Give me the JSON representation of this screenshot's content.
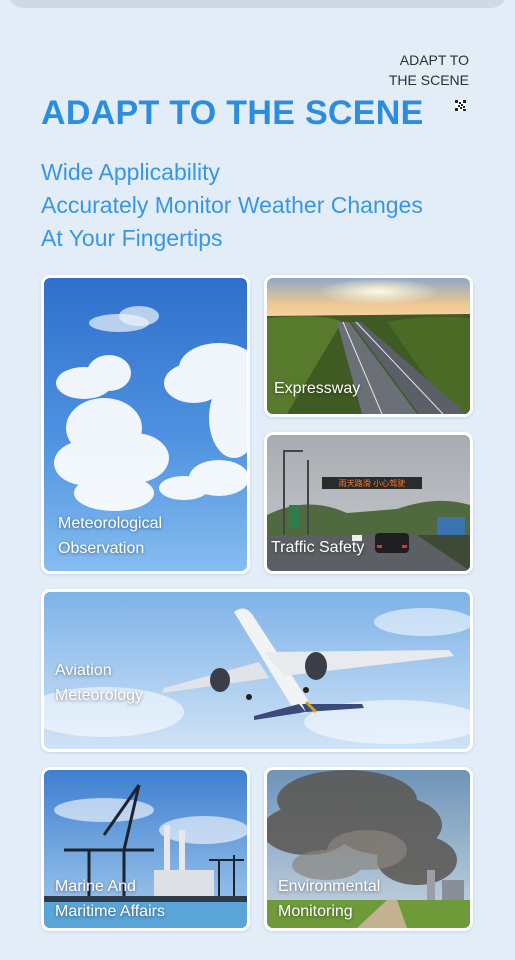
{
  "tag": {
    "line1": "ADAPT TO",
    "line2": "THE SCENE"
  },
  "heading": "ADAPT TO THE SCENE",
  "features": [
    "Wide Applicability",
    "Accurately Monitor Weather Changes",
    "At Your Fingertips"
  ],
  "cards": {
    "meteorological": {
      "line1": "Meteorological",
      "line2": "Observation",
      "icon": "sky-clouds-image"
    },
    "expressway": {
      "line1": "Expressway",
      "icon": "highway-image"
    },
    "traffic": {
      "line1": "Traffic Safety",
      "sign_text": "雨天路滑 小心驾驶",
      "icon": "road-sign-image"
    },
    "aviation": {
      "line1": "Aviation",
      "line2": "Meteorology",
      "icon": "airplane-image"
    },
    "marine": {
      "line1": "Marine And",
      "line2": "Maritime Affairs",
      "icon": "port-cranes-image"
    },
    "environmental": {
      "line1": "Environmental",
      "line2": "Monitoring",
      "icon": "factory-smoke-image"
    }
  },
  "colors": {
    "accent": "#2c8de0",
    "background": "#e3edf8",
    "text_dark": "#2b2f36"
  }
}
